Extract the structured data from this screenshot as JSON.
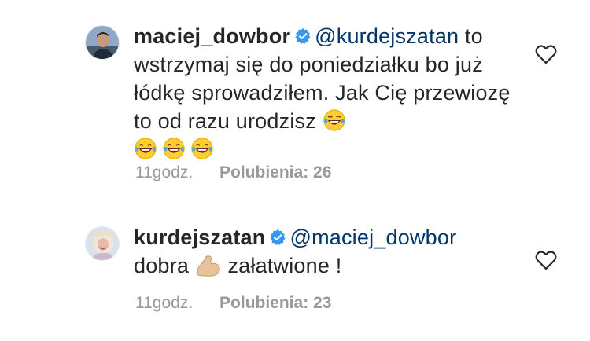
{
  "comments": [
    {
      "username": "maciej_dowbor",
      "mention": "@kurdejszatan",
      "text_line_1_suffix": " to",
      "text_body": "wstrzymaj się do poniedziałku bo już łódkę sprowadziłem. Jak Cię przewiozę to od razu urodzisz",
      "emoji": [
        "laughing-tears-emoji",
        "laughing-tears-emoji",
        "laughing-tears-emoji",
        "laughing-tears-emoji"
      ],
      "time": "11godz.",
      "likes": "Polubienia: 26",
      "avatar": "avatar-man"
    },
    {
      "username": "kurdejszatan",
      "mention": "@maciej_dowbor",
      "text_before": "dobra",
      "text_after": "załatwione !",
      "emoji": [
        "flexed-biceps-emoji"
      ],
      "time": "11godz.",
      "likes": "Polubienia: 23",
      "avatar": "avatar-woman"
    }
  ],
  "icons": {
    "verified": "verified-badge-icon",
    "like": "heart-outline-icon"
  },
  "colors": {
    "verified": "#3897f0",
    "mention": "#003569",
    "meta": "#999999"
  }
}
